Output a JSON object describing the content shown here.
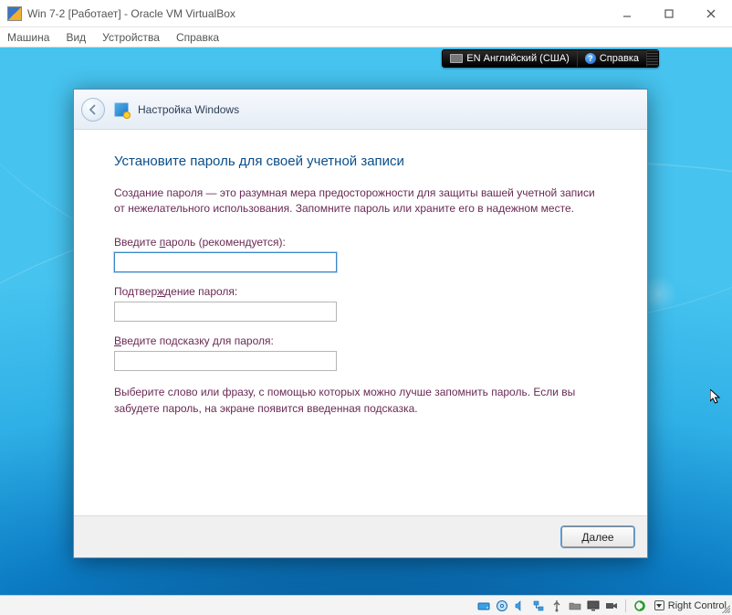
{
  "vb": {
    "title": "Win 7-2 [Работает] - Oracle VM VirtualBox",
    "menu": {
      "machine": "Машина",
      "view": "Вид",
      "devices": "Устройства",
      "help": "Справка"
    }
  },
  "floatbar": {
    "lang_icon": "keyboard-icon",
    "language": "EN Английский (США)",
    "help_label": "Справка"
  },
  "wizard": {
    "header": "Настройка Windows",
    "title": "Установите пароль для своей учетной записи",
    "description": "Создание пароля — это разумная мера предосторожности для защиты вашей учетной записи от нежелательного использования. Запомните пароль или храните его в надежном месте.",
    "password": {
      "label_pre": "Введите ",
      "label_ul": "п",
      "label_post": "ароль (рекомендуется):",
      "value": ""
    },
    "confirm": {
      "label_pre": "Подтвер",
      "label_ul": "ж",
      "label_post": "дение пароля:",
      "value": ""
    },
    "hint": {
      "label_pre": "",
      "label_ul": "В",
      "label_post": "ведите подсказку для пароля:",
      "value": ""
    },
    "hint_desc": "Выберите слово или фразу, с помощью которых можно лучше запомнить пароль. Если вы забудете пароль, на экране появится введенная подсказка.",
    "next_ul": "Д",
    "next_rest": "алее"
  },
  "statusbar": {
    "hostkey": "Right Control"
  }
}
